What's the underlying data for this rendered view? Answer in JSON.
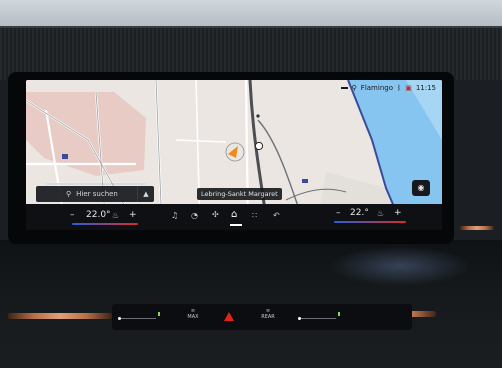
{
  "status_bar": {
    "source_label": "Flamingo",
    "time": "11:15",
    "icons": [
      "bluetooth-icon",
      "phone-icon",
      "calendar-icon"
    ]
  },
  "map": {
    "search_placeholder": "Hier suchen",
    "road_label": "Lebring-Sankt Margaret",
    "position_marker_color": "#f08a1a"
  },
  "climate": {
    "left_temp": "22.0°",
    "right_temp": "22.°",
    "minus": "–",
    "plus": "+",
    "minus_r": "–",
    "plus_r": "+"
  },
  "dock": {
    "items": [
      "music-note-icon",
      "assist-icon",
      "fan-icon",
      "home-icon",
      "grid-icon",
      "back-arrow-icon"
    ]
  },
  "physical_controls": {
    "max_label": "MAX",
    "rear_label": "REAR",
    "hazard_color": "#e2231a"
  },
  "colors": {
    "map_land": "#e9e4e0",
    "map_water": "#7ec0f0",
    "trim": "#c07850"
  }
}
